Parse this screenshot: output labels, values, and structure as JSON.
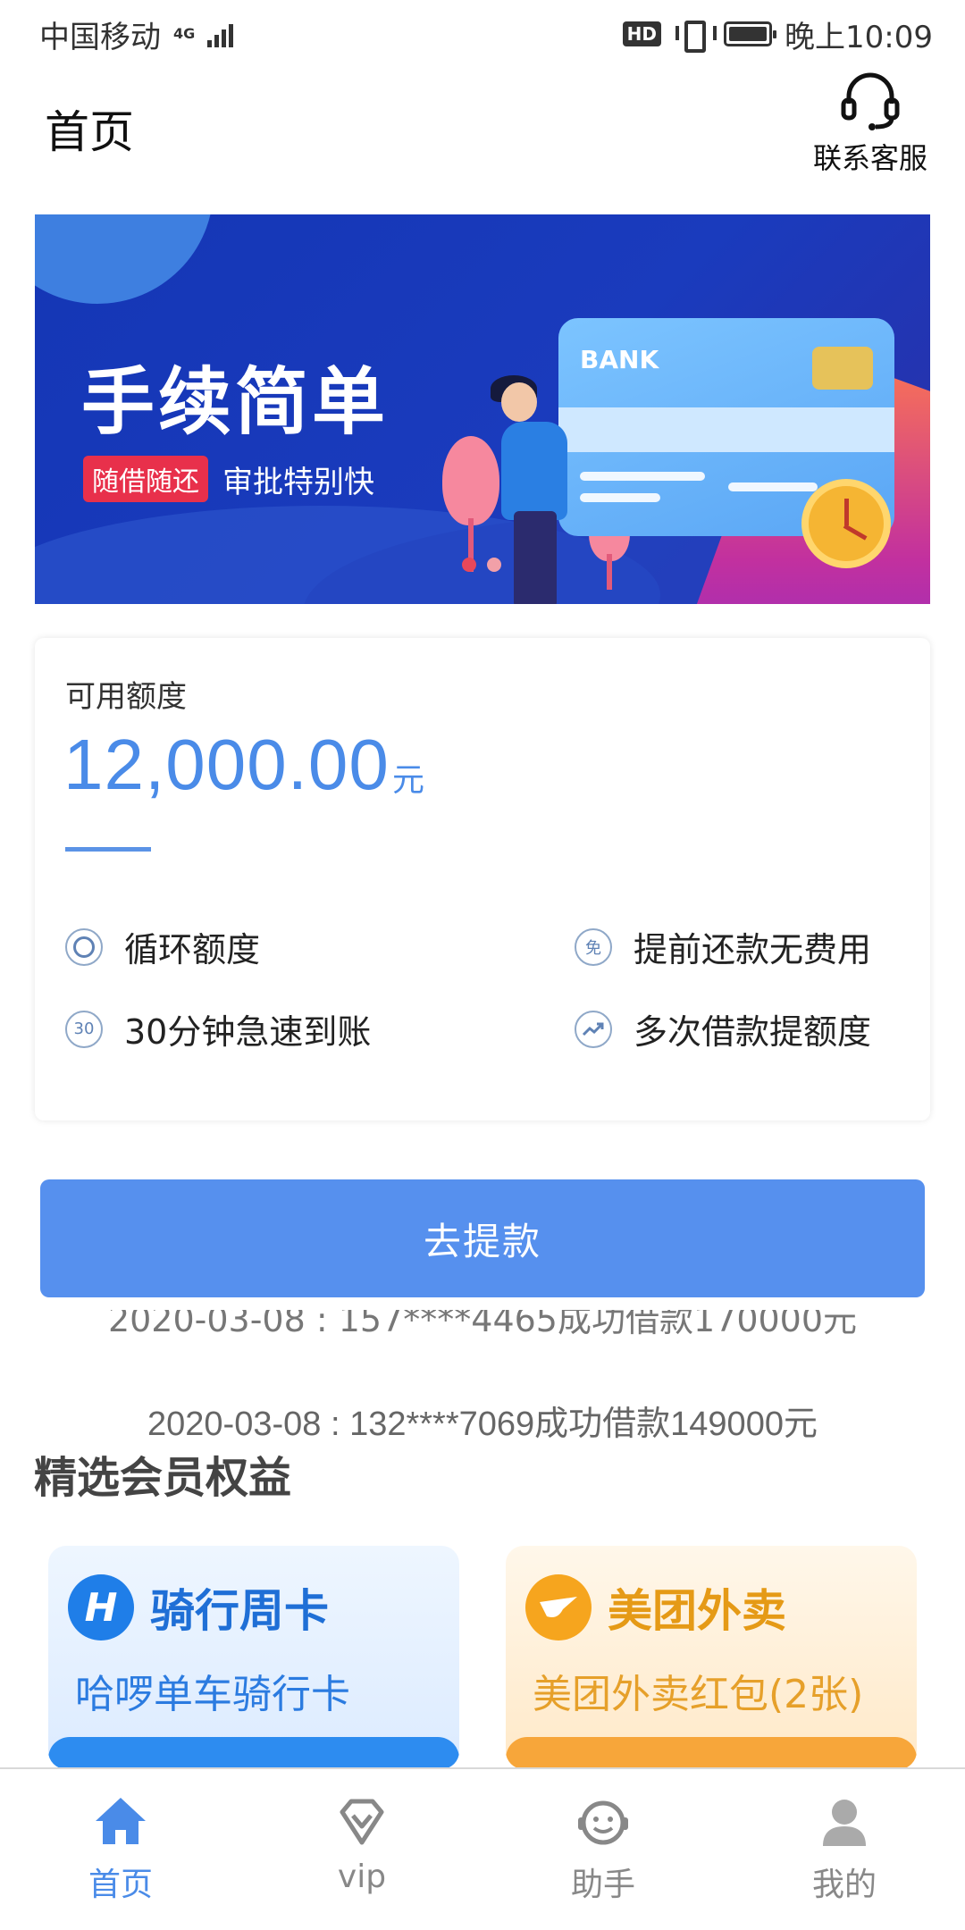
{
  "status_bar": {
    "carrier": "中国移动",
    "network": "4G",
    "hd": "HD",
    "time": "晚上10:09"
  },
  "header": {
    "title": "首页",
    "service_label": "联系客服"
  },
  "banner": {
    "headline": "手续简单",
    "tag": "随借随还",
    "subtitle": "审批特别快",
    "card_label": "BANK",
    "slide_count": 2,
    "active_slide": 1,
    "colors": {
      "background": "#1436b5",
      "tag": "#e8304b"
    }
  },
  "quota": {
    "label": "可用额度",
    "amount": "12,000.00",
    "unit": "元",
    "features": [
      {
        "icon": "circle-loop-icon",
        "label": "循环额度"
      },
      {
        "icon": "free-icon",
        "icon_text": "免",
        "label": "提前还款无费用"
      },
      {
        "icon": "thirty-minutes-icon",
        "icon_text": "30",
        "label": "30分钟急速到账"
      },
      {
        "icon": "trend-up-icon",
        "label": "多次借款提额度"
      }
    ],
    "accent_color": "#4a8be8"
  },
  "withdraw": {
    "label": "去提款",
    "color": "#5690ee"
  },
  "ticker": {
    "previous": "2020-03-08 : 157****4465成功借款170000元",
    "current": "2020-03-08 : 132****7069成功借款149000元"
  },
  "benefits": {
    "title": "精选会员权益",
    "cards": [
      {
        "logo_text": "H",
        "name": "骑行周卡",
        "desc": "哈啰单车骑行卡"
      },
      {
        "logo_text": "",
        "name": "美团外卖",
        "desc": "美团外卖红包(2张)"
      }
    ]
  },
  "bottom_nav": {
    "items": [
      {
        "label": "首页",
        "icon": "home-icon",
        "active": true
      },
      {
        "label": "vip",
        "icon": "vip-diamond-icon",
        "active": false
      },
      {
        "label": "助手",
        "icon": "assistant-icon",
        "active": false
      },
      {
        "label": "我的",
        "icon": "profile-icon",
        "active": false
      }
    ],
    "active_color": "#4a8be8",
    "inactive_color": "#888888"
  }
}
